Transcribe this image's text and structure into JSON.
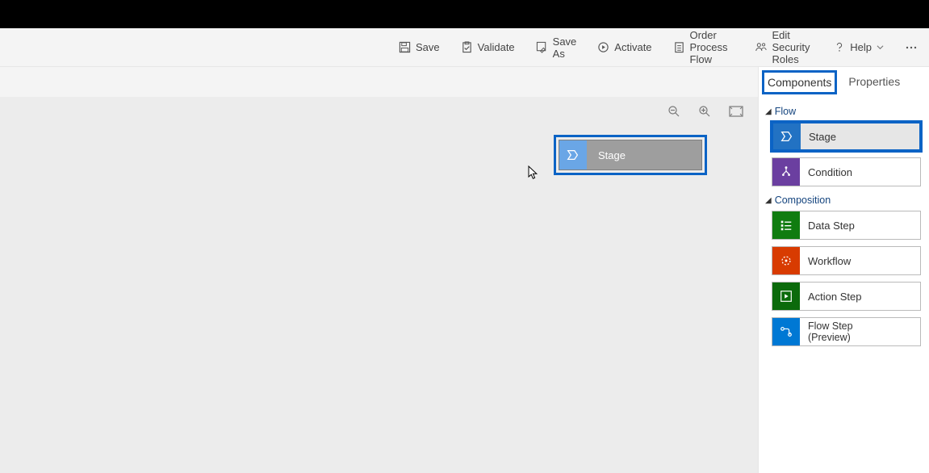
{
  "toolbar": {
    "save": "Save",
    "validate": "Validate",
    "save_as": "Save As",
    "activate": "Activate",
    "order": "Order Process Flow",
    "edit_roles": "Edit Security Roles",
    "help": "Help"
  },
  "canvas": {
    "drag_label": "Stage"
  },
  "side": {
    "tabs": {
      "components": "Components",
      "properties": "Properties"
    },
    "sections": {
      "flow": "Flow",
      "composition": "Composition"
    },
    "items": {
      "stage": "Stage",
      "condition": "Condition",
      "data_step": "Data Step",
      "workflow": "Workflow",
      "action_step": "Action Step",
      "flow_step": "Flow Step\n(Preview)"
    }
  }
}
